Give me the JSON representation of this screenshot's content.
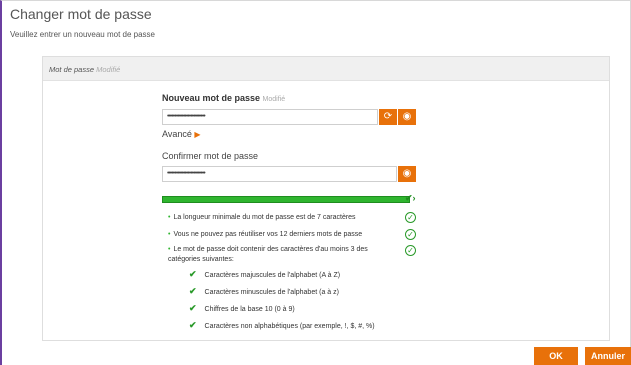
{
  "dialog": {
    "title": "Changer mot de passe",
    "subtitle": "Veuillez entrer un nouveau mot de passe"
  },
  "panel": {
    "header_label": "Mot de passe",
    "header_status": "Modifié"
  },
  "new_password": {
    "label": "Nouveau mot de passe",
    "status": "Modifié",
    "value": "••••••••••••••••••••••••••"
  },
  "advanced": {
    "label": "Avancé",
    "icon": "triangle-right-icon"
  },
  "confirm_password": {
    "label": "Confirmer mot de passe",
    "value": "••••••••••••••••••••••••••"
  },
  "strength": {
    "level": 1.0,
    "color": "#2fb52f"
  },
  "rules": [
    {
      "text": "La longueur minimale du mot de passe est de 7 caractères"
    },
    {
      "text": "Vous ne pouvez pas réutiliser vos 12 derniers mots de passe"
    },
    {
      "text": "Le mot de passe doit contenir des caractères d'au moins 3 des catégories suivantes:"
    }
  ],
  "categories": [
    {
      "text": "Caractères majuscules de l'alphabet (A à Z)"
    },
    {
      "text": "Caractères minuscules de l'alphabet (a à z)"
    },
    {
      "text": "Chiffres de la base 10 (0 à 9)"
    },
    {
      "text": "Caractères non alphabétiques (par exemple, !, $, #, %)"
    }
  ],
  "buttons": {
    "ok": "OK",
    "cancel": "Annuler"
  },
  "colors": {
    "accent": "#e8710a",
    "success": "#2a9a2a",
    "frame": "#6b3fa0"
  }
}
